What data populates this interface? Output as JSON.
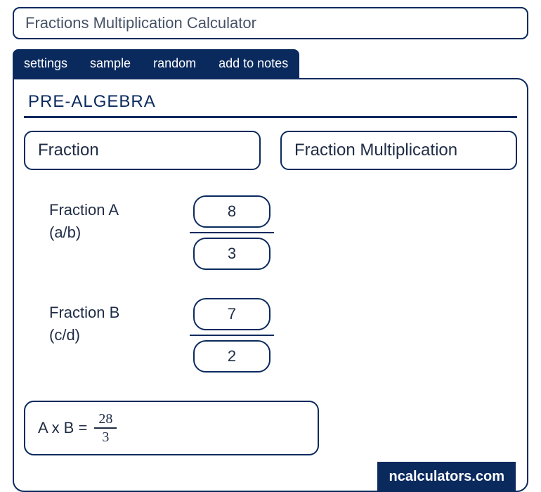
{
  "title": "Fractions Multiplication Calculator",
  "tabs": [
    "settings",
    "sample",
    "random",
    "add to notes"
  ],
  "section": "PRE-ALGEBRA",
  "chips": [
    "Fraction",
    "Fraction Multiplication"
  ],
  "fractionA": {
    "label": "Fraction A",
    "sub": "(a/b)",
    "numerator": "8",
    "denominator": "3"
  },
  "fractionB": {
    "label": "Fraction B",
    "sub": "(c/d)",
    "numerator": "7",
    "denominator": "2"
  },
  "result": {
    "prefix": "A x B  = ",
    "numerator": "28",
    "denominator": "3"
  },
  "brand": "ncalculators.com"
}
